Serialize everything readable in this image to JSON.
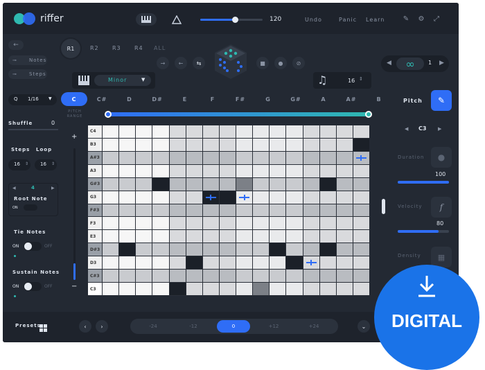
{
  "app": {
    "name": "riffer"
  },
  "topbar": {
    "bpm": "120",
    "undo": "Undo",
    "panic": "Panic",
    "learn": "Learn",
    "bpm_fill": 0.55
  },
  "riffs": {
    "r1": "R1",
    "r2": "R2",
    "r3": "R3",
    "r4": "R4",
    "all": "ALL"
  },
  "modes": {
    "notes": "Notes",
    "steps": "Steps"
  },
  "scale": {
    "name": "Minor"
  },
  "rhythm": {
    "value": "16"
  },
  "quantize": {
    "label": "Q",
    "value": "1/16"
  },
  "keys": [
    "C",
    "C#",
    "D",
    "D#",
    "E",
    "F",
    "F#",
    "G",
    "G#",
    "A",
    "A#",
    "B"
  ],
  "selected_key": "C",
  "pitch_range": "PITCH RANGE",
  "pitch": {
    "label": "Pitch",
    "value": "C3"
  },
  "shuffle": {
    "label": "Shuffle",
    "value": "0"
  },
  "steps": {
    "label": "Steps",
    "value": "16"
  },
  "loop": {
    "label": "Loop",
    "value": "16"
  },
  "root_note": {
    "value": "4",
    "label": "Root Note",
    "toggle": "ON"
  },
  "tie_notes": {
    "label": "Tie Notes",
    "on": "ON",
    "off": "OFF"
  },
  "sustain_notes": {
    "label": "Sustain Notes",
    "on": "ON",
    "off": "OFF"
  },
  "rows": [
    "C4",
    "B3",
    "A#3",
    "A3",
    "G#3",
    "G3",
    "F#3",
    "F3",
    "E3",
    "D#3",
    "D3",
    "C#3",
    "C3"
  ],
  "duration": {
    "label": "Duration",
    "value": "100",
    "fill": 1.0
  },
  "velocity": {
    "label": "Velocity",
    "value": "80",
    "fill": 0.8
  },
  "density": {
    "label": "Density"
  },
  "bottom": {
    "presets": "Presets",
    "octaves": [
      "-24",
      "-12",
      "0",
      "+12",
      "+24"
    ],
    "selected": "0"
  },
  "badge": {
    "text": "DIGITAL"
  },
  "colors": {
    "accent": "#2f6df6",
    "teal": "#2fb9b0",
    "bg": "#232933"
  }
}
